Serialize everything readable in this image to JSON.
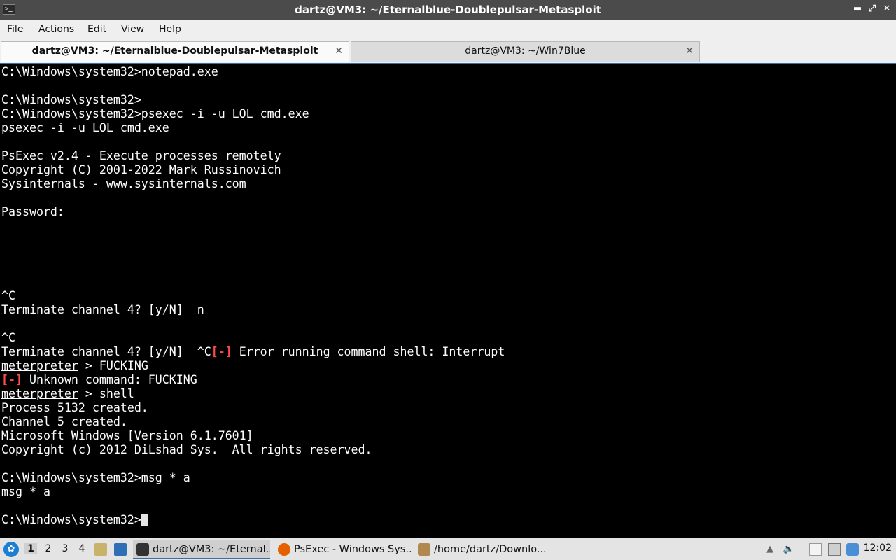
{
  "window": {
    "title": "dartz@VM3: ~/Eternalblue-Doublepulsar-Metasploit",
    "icon_glyph": ">_",
    "controls": [
      "▬",
      "⤢",
      "✕"
    ]
  },
  "menu": [
    "File",
    "Actions",
    "Edit",
    "View",
    "Help"
  ],
  "tabs": [
    {
      "label": "dartz@VM3: ~/Eternalblue-Doublepulsar-Metasploit",
      "active": true
    },
    {
      "label": "dartz@VM3: ~/Win7Blue",
      "active": false
    }
  ],
  "tab_close_glyph": "✕",
  "terminal": {
    "lines": [
      [
        {
          "t": "C:\\Windows\\system32>notepad.exe"
        }
      ],
      [],
      [
        {
          "t": "C:\\Windows\\system32>"
        }
      ],
      [
        {
          "t": "C:\\Windows\\system32>psexec -i -u LOL cmd.exe"
        }
      ],
      [
        {
          "t": "psexec -i -u LOL cmd.exe"
        }
      ],
      [],
      [
        {
          "t": "PsExec v2.4 - Execute processes remotely"
        }
      ],
      [
        {
          "t": "Copyright (C) 2001-2022 Mark Russinovich"
        }
      ],
      [
        {
          "t": "Sysinternals - www.sysinternals.com"
        }
      ],
      [],
      [
        {
          "t": "Password:"
        }
      ],
      [],
      [],
      [],
      [],
      [],
      [
        {
          "t": "^C"
        }
      ],
      [
        {
          "t": "Terminate channel 4? [y/N]  n"
        }
      ],
      [],
      [
        {
          "t": "^C"
        }
      ],
      [
        {
          "t": "Terminate channel 4? [y/N]  ^C"
        },
        {
          "t": "[-]",
          "c": "red"
        },
        {
          "t": " Error running command shell: Interrupt"
        }
      ],
      [
        {
          "t": "meterpreter",
          "c": "ul"
        },
        {
          "t": " > FUCKING"
        }
      ],
      [
        {
          "t": "[-]",
          "c": "red"
        },
        {
          "t": " Unknown command: FUCKING"
        }
      ],
      [
        {
          "t": "meterpreter",
          "c": "ul"
        },
        {
          "t": " > shell"
        }
      ],
      [
        {
          "t": "Process 5132 created."
        }
      ],
      [
        {
          "t": "Channel 5 created."
        }
      ],
      [
        {
          "t": "Microsoft Windows [Version 6.1.7601]"
        }
      ],
      [
        {
          "t": "Copyright (c) 2012 DiLshad Sys.  All rights reserved."
        }
      ],
      [],
      [
        {
          "t": "C:\\Windows\\system32>msg * a"
        }
      ],
      [
        {
          "t": "msg * a"
        }
      ],
      [],
      [
        {
          "t": "C:\\Windows\\system32>"
        },
        {
          "cursor": true
        }
      ]
    ]
  },
  "taskbar": {
    "start_glyph": "✿",
    "workspaces": [
      "1",
      "2",
      "3",
      "4"
    ],
    "current_workspace": "1",
    "tasks": [
      {
        "label": "dartz@VM3: ~/Eternal...",
        "icon": "terminal-icon",
        "color": "#333333",
        "active": true
      },
      {
        "label": "PsExec - Windows Sys...",
        "icon": "firefox-icon",
        "color": "#e66000",
        "active": false
      },
      {
        "label": "/home/dartz/Downlo...",
        "icon": "archive-icon",
        "color": "#b08850",
        "active": false
      }
    ],
    "clock": "12:02"
  }
}
